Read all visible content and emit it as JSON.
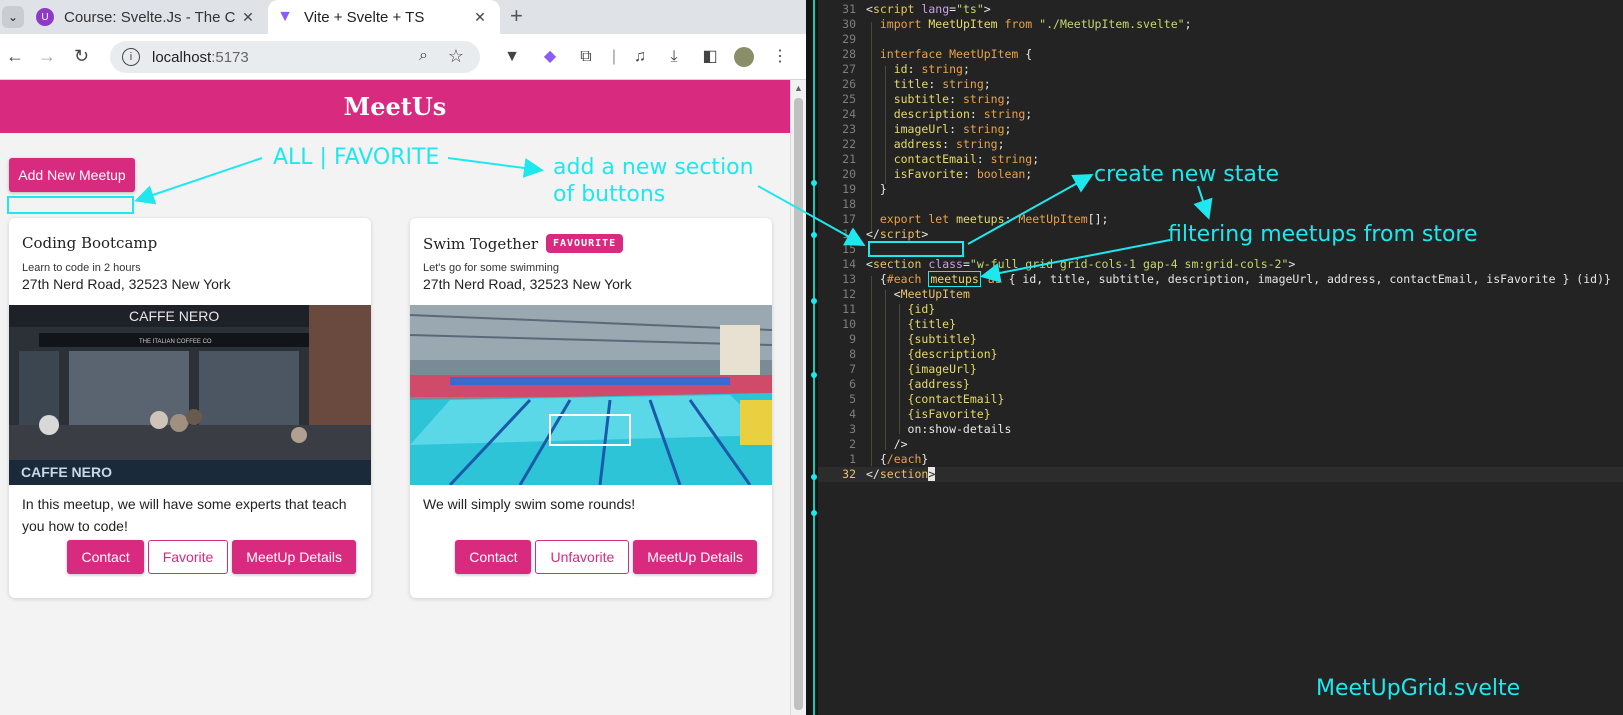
{
  "browser": {
    "tabs": [
      {
        "title": "Course: Svelte.Js - The Co",
        "active": false
      },
      {
        "title": "Vite + Svelte + TS",
        "active": true
      }
    ],
    "url_host": "localhost",
    "url_port": ":5173"
  },
  "app": {
    "header_title": "MeetUs",
    "add_button": "Add New Meetup",
    "meetups": [
      {
        "title": "Coding Bootcamp",
        "subtitle": "Learn to code in 2 hours",
        "address": "27th Nerd Road, 32523 New York",
        "description": "In this meetup, we will have some experts that teach you how to code!",
        "is_favorite": false,
        "contact_label": "Contact",
        "favorite_label": "Favorite",
        "details_label": "MeetUp Details",
        "image_alt": "Caffe Nero storefront with people outside",
        "image_text": "CAFFE NERO",
        "image_subtext": "THE ITALIAN COFFEE CO"
      },
      {
        "title": "Swim Together",
        "badge": "FAVOURITE",
        "subtitle": "Let's go for some swimming",
        "address": "27th Nerd Road, 32523 New York",
        "description": "We will simply swim some rounds!",
        "is_favorite": true,
        "contact_label": "Contact",
        "favorite_label": "Unfavorite",
        "details_label": "MeetUp Details",
        "image_alt": "Indoor swimming pool"
      }
    ]
  },
  "editor": {
    "filename": "MeetUpGrid.svelte",
    "current_line": "32"
  },
  "annotations": {
    "all_favorite": "ALL | FAVORITE",
    "add_section_1": "add a new section",
    "add_section_2": "of buttons",
    "create_state": "create new state",
    "filtering": "filtering meetups from store"
  },
  "colors": {
    "brand": "#d82a7f",
    "annotation": "#1ee8ee",
    "editor_bg": "#232323"
  }
}
